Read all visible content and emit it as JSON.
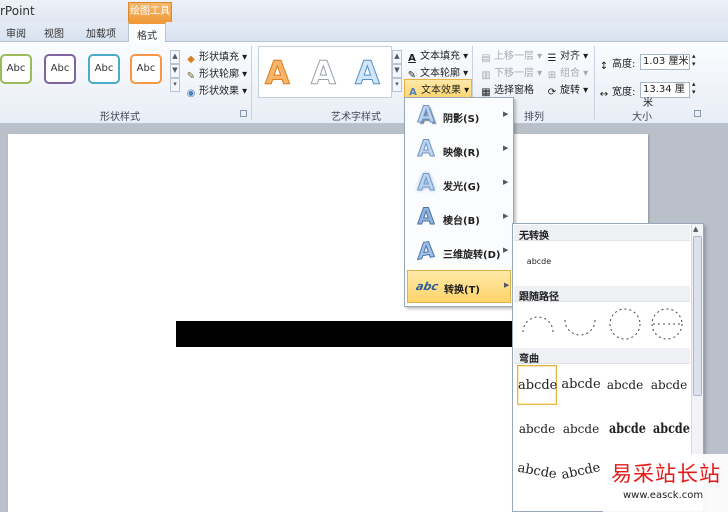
{
  "window": {
    "app_title": "rPoint",
    "context_group": "绘图工具"
  },
  "tabs": [
    {
      "label": "审阅"
    },
    {
      "label": "视图"
    },
    {
      "label": "加载项"
    },
    {
      "label": "格式",
      "active": true
    }
  ],
  "shape_styles": {
    "label": "形状样式",
    "swatches": [
      {
        "label": "Abc",
        "color": "#9bbb59"
      },
      {
        "label": "Abc",
        "color": "#8064a2"
      },
      {
        "label": "Abc",
        "color": "#4bacc6"
      },
      {
        "label": "Abc",
        "color": "#f79646"
      }
    ],
    "fill": "形状填充",
    "outline": "形状轮廓",
    "effects": "形状效果"
  },
  "wordart": {
    "label": "艺术字样式",
    "text_fill": "文本填充",
    "text_outline": "文本轮廓",
    "text_effects": "文本效果",
    "samples": [
      {
        "glyph": "A",
        "color": "#f5b46b",
        "stroke": "#e07a1a"
      },
      {
        "glyph": "A",
        "color": "#ffffff",
        "stroke": "#9aa0a8"
      },
      {
        "glyph": "A",
        "color": "#d2e6f7",
        "stroke": "#4f90cf"
      }
    ]
  },
  "arrange": {
    "label": "排列",
    "bring_forward": "上移一层",
    "send_backward": "下移一层",
    "selection_pane": "选择窗格",
    "align": "对齐",
    "group": "组合",
    "rotate": "旋转"
  },
  "size": {
    "label": "大小",
    "height_label": "高度:",
    "height_value": "1.03 厘米",
    "width_label": "宽度:",
    "width_value": "13.34 厘米"
  },
  "text_effects_menu": [
    {
      "label": "阴影(S)",
      "icon": "A"
    },
    {
      "label": "映像(R)",
      "icon": "A"
    },
    {
      "label": "发光(G)",
      "icon": "A"
    },
    {
      "label": "棱台(B)",
      "icon": "A"
    },
    {
      "label": "三维旋转(D)",
      "icon": "A"
    },
    {
      "label": "转换(T)",
      "icon": "abc",
      "highlighted": true
    }
  ],
  "transform_submenu": {
    "no_transform": "无转换",
    "no_transform_sample": "abcde",
    "follow_path": "跟随路径",
    "warp": "弯曲",
    "warp_samples": [
      [
        "abcde",
        "abcde",
        "abcde",
        "abcde"
      ],
      [
        "abcde",
        "abcde",
        "abcde",
        "abcde"
      ],
      [
        "abcde",
        "abcde",
        "abcde",
        "abcde"
      ]
    ]
  },
  "watermark": {
    "text": "易采站长站",
    "url": "www.easck.com"
  }
}
